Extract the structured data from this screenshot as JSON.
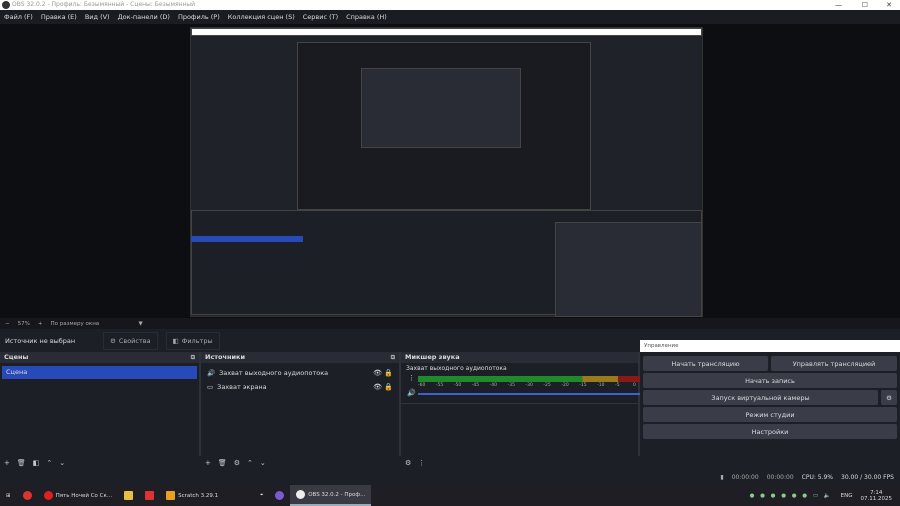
{
  "window": {
    "title": "OBS 32.0.2 - Профиль: Безымянный - Сцены: Безымянный"
  },
  "menu": [
    "Файл (F)",
    "Правка (E)",
    "Вид (V)",
    "Док-панели (D)",
    "Профиль (P)",
    "Коллекция сцен (S)",
    "Сервис (T)",
    "Справка (H)"
  ],
  "zoom": {
    "minus": "−",
    "value": "57%",
    "plus": "+",
    "mode": "По размеру окна"
  },
  "source_toolbar": {
    "status": "Источник не выбран",
    "properties": "Свойства",
    "filters": "Фильтры"
  },
  "scenes": {
    "title": "Сцены",
    "items": [
      "Сцена"
    ]
  },
  "sources": {
    "title": "Источники",
    "items": [
      {
        "name": "Захват выходного аудиопотока",
        "icon": "speaker-icon"
      },
      {
        "name": "Захват экрана",
        "icon": "monitor-icon"
      }
    ]
  },
  "mixer": {
    "title": "Микшер звука",
    "channel": "Захват выходного аудиопотока",
    "ticks": [
      "-60",
      "-55",
      "-50",
      "-45",
      "-40",
      "-35",
      "-30",
      "-25",
      "-20",
      "-15",
      "-10",
      "-5",
      "0"
    ],
    "colors": {
      "green": "#1f8a2a",
      "yellow": "#9a7a1a",
      "red": "#8a1a1a",
      "volume": "#4060d0"
    }
  },
  "controls": {
    "title": "Управление",
    "start_stream": "Начать трансляцию",
    "manage_stream": "Управлять трансляцией",
    "start_record": "Начать запись",
    "virtual_cam": "Запуск виртуальной камеры",
    "studio_mode": "Режим студии",
    "settings": "Настройки"
  },
  "status": {
    "stream_time": "00:00:00",
    "rec_time": "00:00:00",
    "cpu": "CPU: 5.9%",
    "fps": "30.00 / 30.00 FPS"
  },
  "taskbar": {
    "apps": [
      {
        "label": "Пять Ночей Со Ск...",
        "color": "#e02020"
      },
      {
        "label": "Scratch 3.29.1",
        "color": "#e8a020"
      },
      {
        "label": "OBS 32.0.2 - Проф...",
        "color": "#eee",
        "active": true
      }
    ],
    "lang": "ENG",
    "time": "7:14",
    "date": "07.11.2025"
  }
}
